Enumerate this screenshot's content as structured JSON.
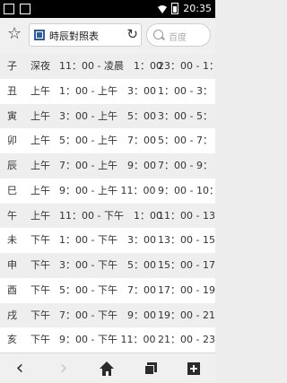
{
  "status_bar": {
    "time": "20:35"
  },
  "toolbar": {
    "page_title": "時辰對照表",
    "search_placeholder": "百度"
  },
  "table": {
    "rows": [
      {
        "branch": "子",
        "period": "深夜",
        "range": "11：00 - 凌晨　1：00",
        "clock": "23：00 - 1："
      },
      {
        "branch": "丑",
        "period": "上午",
        "range": "1：00 - 上午　3：00",
        "clock": "1：00 - 3："
      },
      {
        "branch": "寅",
        "period": "上午",
        "range": "3：00 - 上午　5：00",
        "clock": "3：00 - 5："
      },
      {
        "branch": "卯",
        "period": "上午",
        "range": "5：00 - 上午　7：00",
        "clock": "5：00 - 7："
      },
      {
        "branch": "辰",
        "period": "上午",
        "range": "7：00 - 上午　9：00",
        "clock": "7：00 - 9："
      },
      {
        "branch": "巳",
        "period": "上午",
        "range": "9：00 - 上午 11：00",
        "clock": "9：00 - 10："
      },
      {
        "branch": "午",
        "period": "上午",
        "range": "11：00 - 下午　1：00",
        "clock": "11：00 - 13："
      },
      {
        "branch": "未",
        "period": "下午",
        "range": "1：00 - 下午　3：00",
        "clock": "13：00 - 15："
      },
      {
        "branch": "申",
        "period": "下午",
        "range": "3：00 - 下午　5：00",
        "clock": "15：00 - 17："
      },
      {
        "branch": "酉",
        "period": "下午",
        "range": "5：00 - 下午　7：00",
        "clock": "17：00 - 19："
      },
      {
        "branch": "戌",
        "period": "下午",
        "range": "7：00 - 下午　9：00",
        "clock": "19：00 - 21："
      },
      {
        "branch": "亥",
        "period": "下午",
        "range": "9：00 - 下午 11：00",
        "clock": "21：00 - 23："
      }
    ]
  },
  "icons": {
    "bookmark": "star-icon",
    "favicon": "favicon-icon",
    "reload": "reload-icon",
    "search": "search-icon",
    "back": "back-icon",
    "forward": "forward-icon",
    "home": "home-icon",
    "tabs": "tabs-icon",
    "new_tab": "plus-icon"
  }
}
